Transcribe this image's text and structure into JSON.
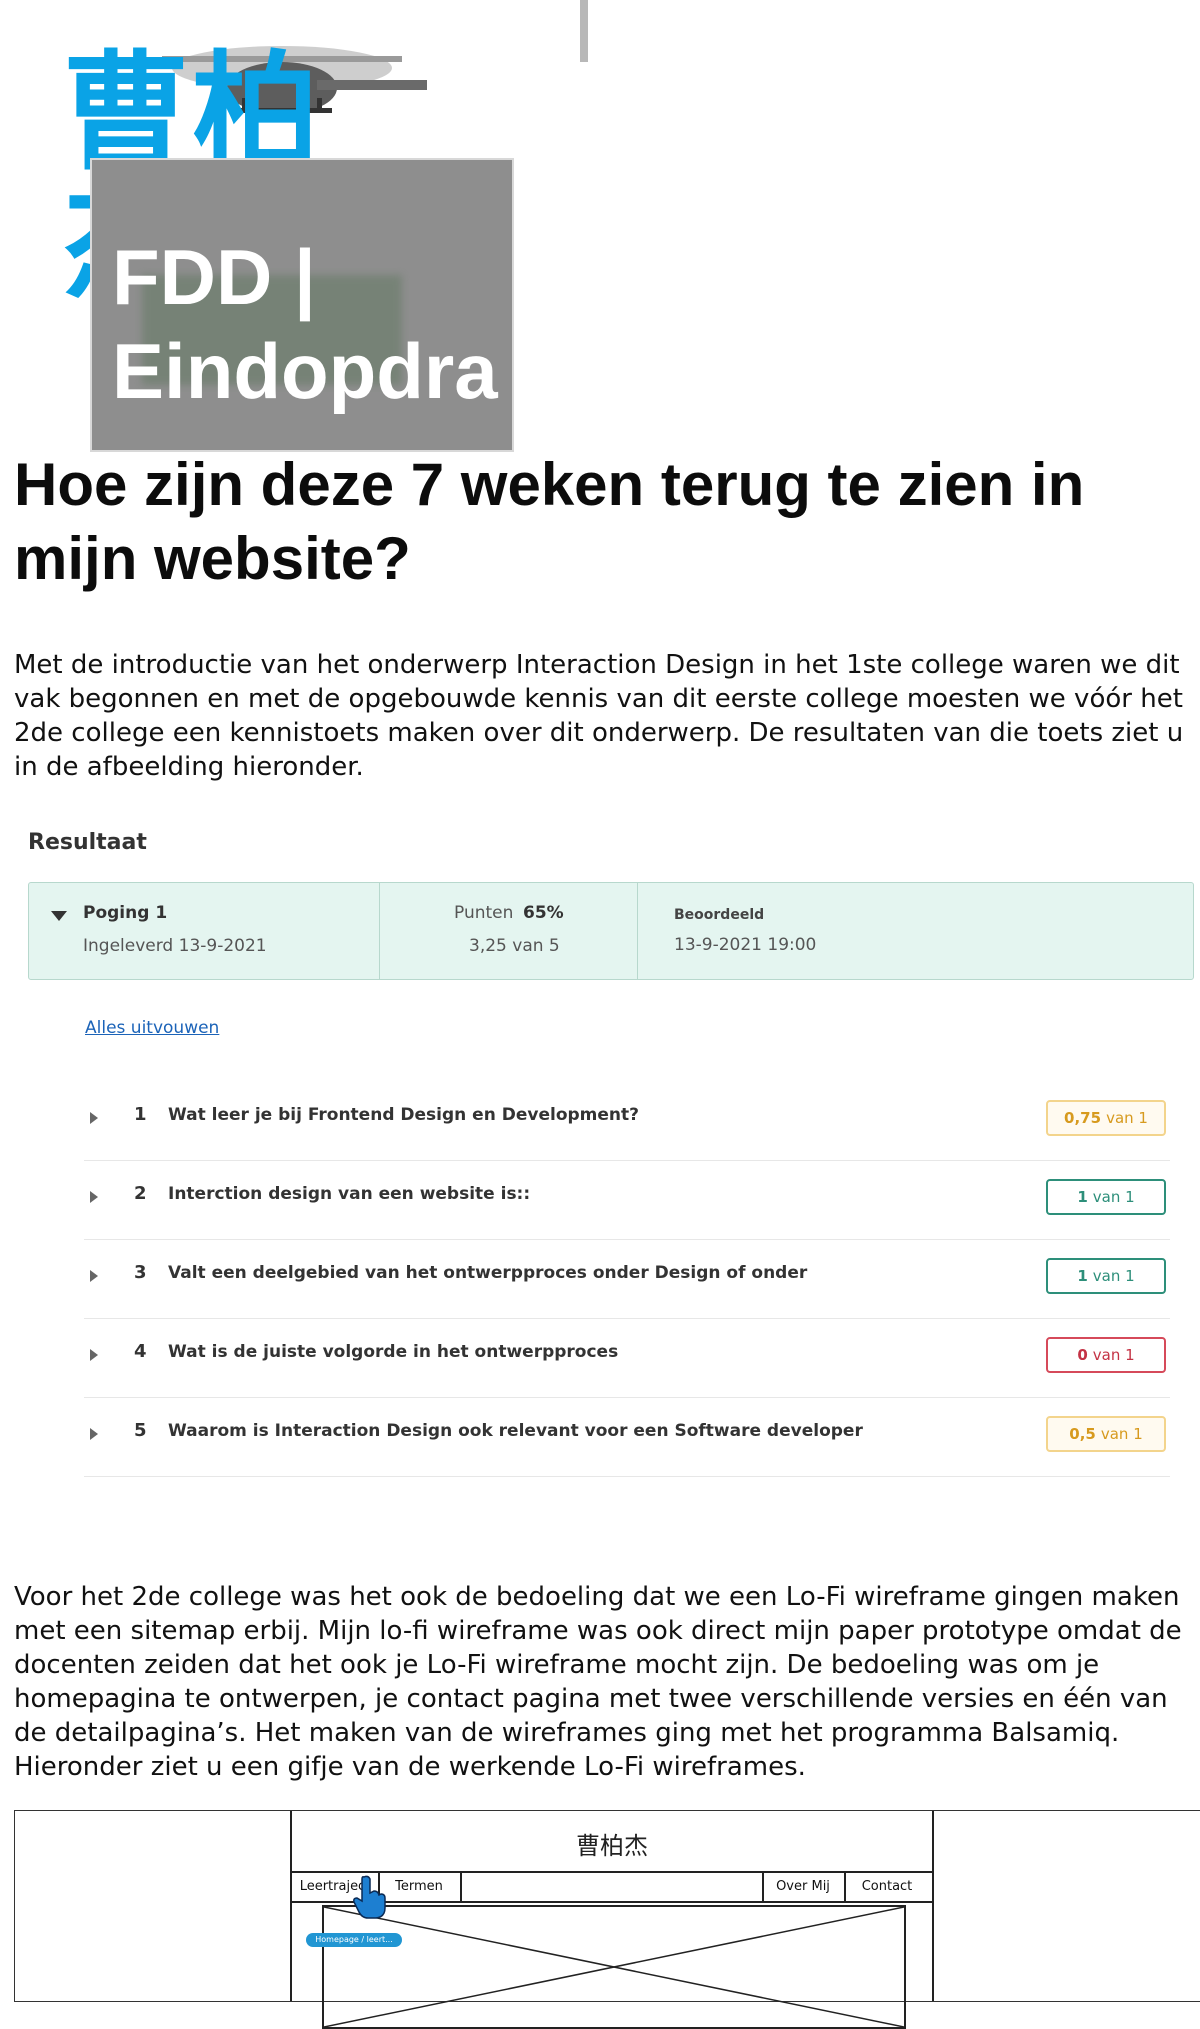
{
  "brand": {
    "logo_text": "曹柏杰"
  },
  "hero_card": {
    "title": "FDD |\nEindopdra"
  },
  "article": {
    "heading": "Hoe zijn deze 7 weken terug te zien in mijn website?",
    "paragraph1": "Met de introductie van het onderwerp Interaction Design in het 1ste college waren we dit vak begonnen en met de opgebouwde kennis van dit eerste college moesten we vóór het 2de college een kennistoets maken over dit onderwerp. De resultaten van die toets ziet u in de afbeelding hieronder.",
    "paragraph2": "Voor het 2de college was het ook de bedoeling dat we een Lo-Fi wireframe gingen maken met een sitemap erbij. Mijn lo-fi wireframe was ook direct mijn paper prototype omdat de docenten zeiden dat het ook je Lo-Fi wireframe mocht zijn. De bedoeling was om je homepagina te ontwerpen, je contact pagina met twee verschillende versies en één van de detailpagina’s. Het maken van de wireframes ging met het programma Balsamiq. Hieronder ziet u een gifje van de werkende Lo-Fi wireframes."
  },
  "result_screenshot": {
    "title": "Resultaat",
    "attempt_label": "Poging 1",
    "submitted": "Ingeleverd 13-9-2021",
    "points_label": "Punten",
    "points_pct": "65%",
    "score": "3,25 van 5",
    "graded_label": "Beoordeeld",
    "graded_date": "13-9-2021 19:00",
    "expand_all": "Alles uitvouwen",
    "questions": [
      {
        "num": "1",
        "text": "Wat leer je bij Frontend Design en Development?",
        "points": "0,75",
        "of": "van 1",
        "status": "partial"
      },
      {
        "num": "2",
        "text": "Interction design van een website is::",
        "points": "1",
        "of": "van 1",
        "status": "correct"
      },
      {
        "num": "3",
        "text": "Valt een deelgebied van het ontwerpproces onder Design of onder",
        "points": "1",
        "of": "van 1",
        "status": "correct"
      },
      {
        "num": "4",
        "text": "Wat is de juiste volgorde in het ontwerpproces",
        "points": "0",
        "of": "van 1",
        "status": "wrong"
      },
      {
        "num": "5",
        "text": "Waarom is Interaction Design ook relevant voor een Software developer",
        "points": "0,5",
        "of": "van 1",
        "status": "partial"
      }
    ],
    "status_colors": {
      "partial": {
        "border": "#f3d48c",
        "text": "#d79a1e",
        "bg": "#fffaf0"
      },
      "correct": {
        "border": "#2d8f7a",
        "text": "#2d8f7a",
        "bg": "#ffffff"
      },
      "wrong": {
        "border": "#d64a5a",
        "text": "#c43345",
        "bg": "#ffffff"
      }
    }
  },
  "wireframe": {
    "logo": "曹柏杰",
    "nav": [
      "Leertraject",
      "Termen",
      "Over Mij",
      "Contact"
    ],
    "chip": "Homepage / leert..."
  },
  "colors": {
    "brand_blue": "#0aa3e6",
    "panel_bg": "#e4f5f0",
    "link": "#1b63b8"
  }
}
